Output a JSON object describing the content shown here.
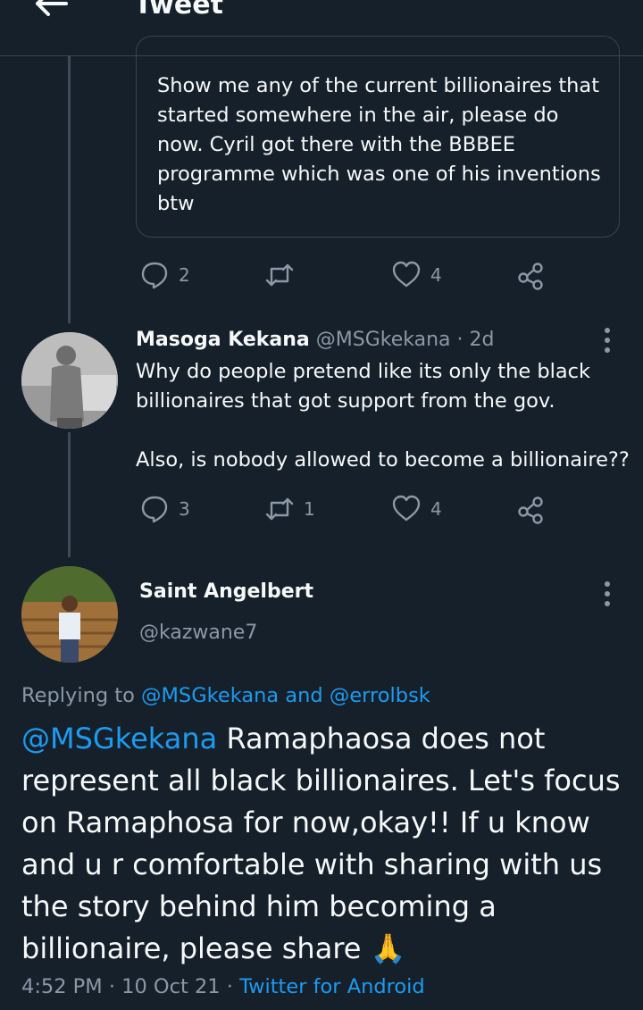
{
  "header": {
    "title": "Tweet"
  },
  "quoted_tweet": {
    "text": "Show me any of the current billionaires that started somewhere in the air, please do now. Cyril got there with the BBBEE programme which was one of his inventions btw",
    "actions": {
      "replies": "2",
      "retweets": "",
      "likes": "4"
    }
  },
  "reply_tweet": {
    "name": "Masoga Kekana",
    "handle": "@MSGkekana",
    "time": "· 2d",
    "text_line1": "Why do people pretend like its only the black billionaires that got support from the gov.",
    "text_line2": "Also, is nobody allowed to become a billionaire??",
    "actions": {
      "replies": "3",
      "retweets": "1",
      "likes": "4"
    }
  },
  "main_tweet": {
    "name": "Saint Angelbert",
    "handle": "@kazwane7",
    "replying_label": "Replying to",
    "replying_users": "@MSGkekana and @errolbsk",
    "mention": "@MSGkekana",
    "text": " Ramaphaosa does not represent all black billionaires. Let's focus on Ramaphosa for now,okay!! If u know and u r comfortable with sharing with us the story behind him becoming a billionaire, please share",
    "emoji": "🙏",
    "time": "4:52 PM",
    "date": "· 10 Oct 21 ·",
    "source": "Twitter for Android"
  },
  "colors": {
    "background": "#15202b",
    "link": "#1d9bf0",
    "muted": "#8b98a5",
    "border": "#38444d"
  },
  "icons": [
    "back-arrow-icon",
    "reply-icon",
    "retweet-icon",
    "like-icon",
    "share-icon",
    "more-icon"
  ]
}
